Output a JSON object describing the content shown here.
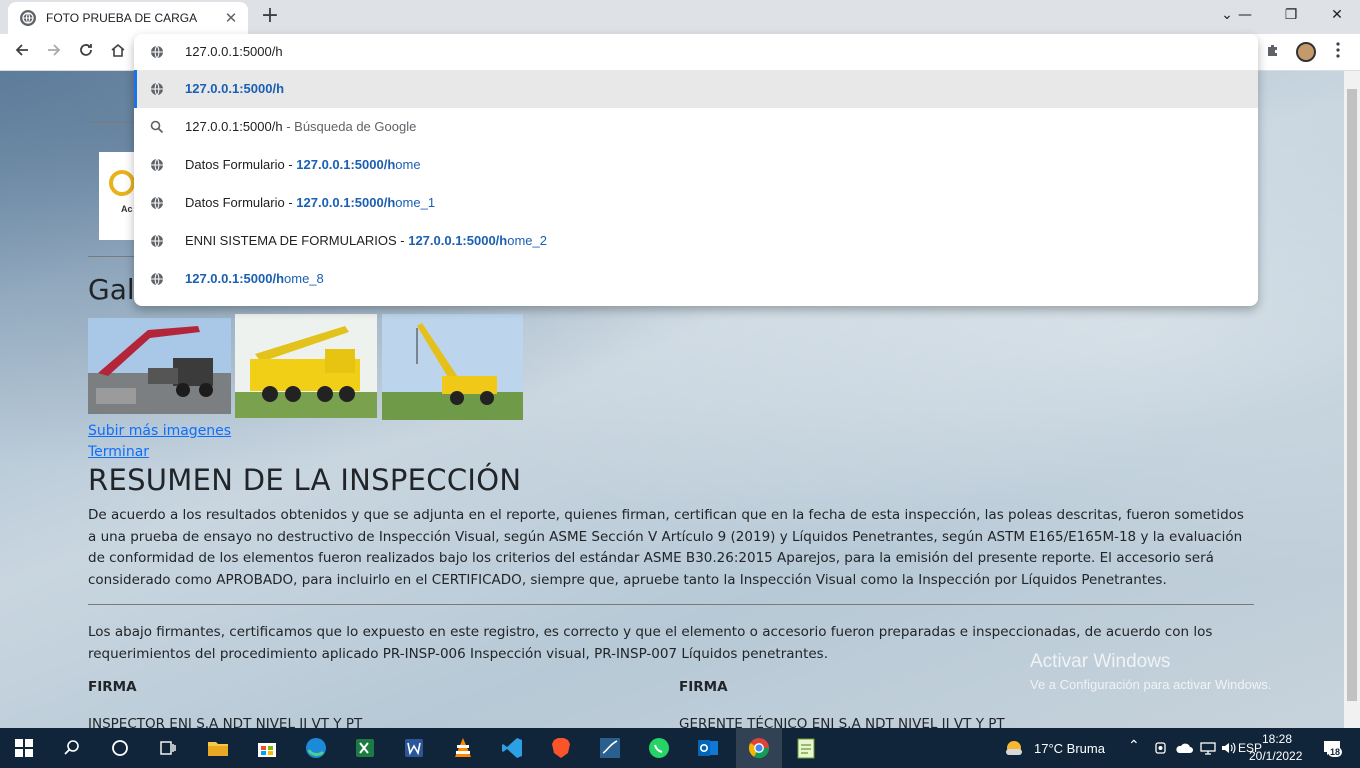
{
  "browser": {
    "tab_title": "FOTO PRUEBA DE CARGA",
    "tab_close": "✕",
    "new_tab": "+",
    "address_text": "127.0.0.1:5000/h",
    "window_controls": {
      "dropdown": "⌄",
      "minimize": "—",
      "restore": "❐",
      "close": "✕"
    }
  },
  "suggestions": [
    {
      "title": "",
      "sep": "",
      "url_bold": "127.0.0.1:5000/h",
      "url_rest": "",
      "desc": "",
      "icon": "globe-icon"
    },
    {
      "title": "127.0.0.1:5000/h",
      "sep": " - ",
      "url_bold": "",
      "url_rest": "",
      "desc": "Búsqueda de Google",
      "icon": "search-icon"
    },
    {
      "title": "Datos Formulario",
      "sep": " - ",
      "url_bold": "127.0.0.1:5000/h",
      "url_rest": "ome",
      "desc": "",
      "icon": "globe-icon"
    },
    {
      "title": "Datos Formulario",
      "sep": " - ",
      "url_bold": "127.0.0.1:5000/h",
      "url_rest": "ome_1",
      "desc": "",
      "icon": "globe-icon"
    },
    {
      "title": "ENNI SISTEMA DE FORMULARIOS",
      "sep": " - ",
      "url_bold": "127.0.0.1:5000/h",
      "url_rest": "ome_2",
      "desc": "",
      "icon": "globe-icon"
    },
    {
      "title": "",
      "sep": "",
      "url_bold": "127.0.0.1:5000/h",
      "url_rest": "ome_8",
      "desc": "",
      "icon": "globe-icon"
    }
  ],
  "page": {
    "gallery_title_visible": "Gale",
    "logo_fragment": "Ac",
    "upload_link": "Subir más imagenes",
    "finish_link": "Terminar",
    "summary_title": "RESUMEN DE LA INSPECCIÓN",
    "summary_p1": "De acuerdo a los resultados obtenidos y que se adjunta en el reporte, quienes firman, certifican que en la fecha de esta inspección, las poleas descritas, fueron sometidos a una prueba de ensayo no destructivo de Inspección Visual, según ASME Sección V Artículo 9 (2019) y Líquidos Penetrantes, según ASTM E165/E165M-18 y la evaluación de conformidad de los elementos fueron realizados bajo los criterios del estándar ASME B30.26:2015 Aparejos, para la emisión del presente reporte. El accesorio será considerado como APROBADO, para incluirlo en el CERTIFICADO, siempre que, apruebe tanto la Inspección Visual como la Inspección por Líquidos Penetrantes.",
    "summary_p2": "Los abajo firmantes, certificamos que lo expuesto en este registro, es correcto y que el elemento o accesorio fueron preparadas e inspeccionadas, de acuerdo con los requerimientos del procedimiento aplicado PR-INSP-006 Inspección visual, PR-INSP-007 Líquidos penetrantes.",
    "sign_left": "FIRMA",
    "sign_right": "FIRMA",
    "role_left": "INSPECTOR ENI S.A NDT NIVEL II VT Y PT",
    "role_right": "GERENTE TÉCNICO ENI S.A NDT NIVEL II VT Y PT",
    "watermark_title": "Activar Windows",
    "watermark_sub": "Ve a Configuración para activar Windows."
  },
  "taskbar": {
    "weather": "17°C  Bruma",
    "time": "18:28",
    "date": "20/1/2022",
    "notifications": "18"
  },
  "colors": {
    "accent": "#1a73e8",
    "link": "#0d6efd",
    "taskbar": "#10243a"
  }
}
